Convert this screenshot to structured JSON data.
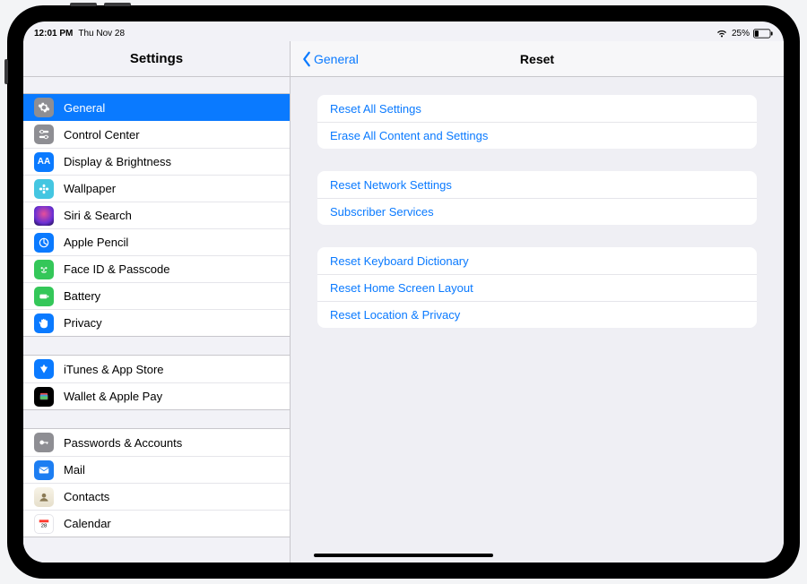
{
  "status": {
    "time": "12:01 PM",
    "date": "Thu Nov 28",
    "battery_pct": "25%"
  },
  "sidebar": {
    "title": "Settings",
    "groups": [
      {
        "items": [
          {
            "key": "general",
            "label": "General",
            "icon": "gear-icon",
            "selected": true
          },
          {
            "key": "control-center",
            "label": "Control Center",
            "icon": "switches-icon"
          },
          {
            "key": "display",
            "label": "Display & Brightness",
            "icon": "aa-icon"
          },
          {
            "key": "wallpaper",
            "label": "Wallpaper",
            "icon": "flower-icon"
          },
          {
            "key": "siri",
            "label": "Siri & Search",
            "icon": "siri-icon"
          },
          {
            "key": "pencil",
            "label": "Apple Pencil",
            "icon": "pencil-icon"
          },
          {
            "key": "faceid",
            "label": "Face ID & Passcode",
            "icon": "face-icon"
          },
          {
            "key": "battery",
            "label": "Battery",
            "icon": "battery-icon"
          },
          {
            "key": "privacy",
            "label": "Privacy",
            "icon": "hand-icon"
          }
        ]
      },
      {
        "items": [
          {
            "key": "itunes",
            "label": "iTunes & App Store",
            "icon": "appstore-icon"
          },
          {
            "key": "wallet",
            "label": "Wallet & Apple Pay",
            "icon": "wallet-icon"
          }
        ]
      },
      {
        "items": [
          {
            "key": "passwords",
            "label": "Passwords & Accounts",
            "icon": "key-icon"
          },
          {
            "key": "mail",
            "label": "Mail",
            "icon": "mail-icon"
          },
          {
            "key": "contacts",
            "label": "Contacts",
            "icon": "contacts-icon"
          },
          {
            "key": "calendar",
            "label": "Calendar",
            "icon": "calendar-icon"
          }
        ]
      }
    ]
  },
  "detail": {
    "back_label": "General",
    "title": "Reset",
    "groups": [
      {
        "items": [
          {
            "label": "Reset All Settings"
          },
          {
            "label": "Erase All Content and Settings"
          }
        ]
      },
      {
        "items": [
          {
            "label": "Reset Network Settings"
          },
          {
            "label": "Subscriber Services"
          }
        ]
      },
      {
        "items": [
          {
            "label": "Reset Keyboard Dictionary"
          },
          {
            "label": "Reset Home Screen Layout"
          },
          {
            "label": "Reset Location & Privacy"
          }
        ]
      }
    ]
  }
}
